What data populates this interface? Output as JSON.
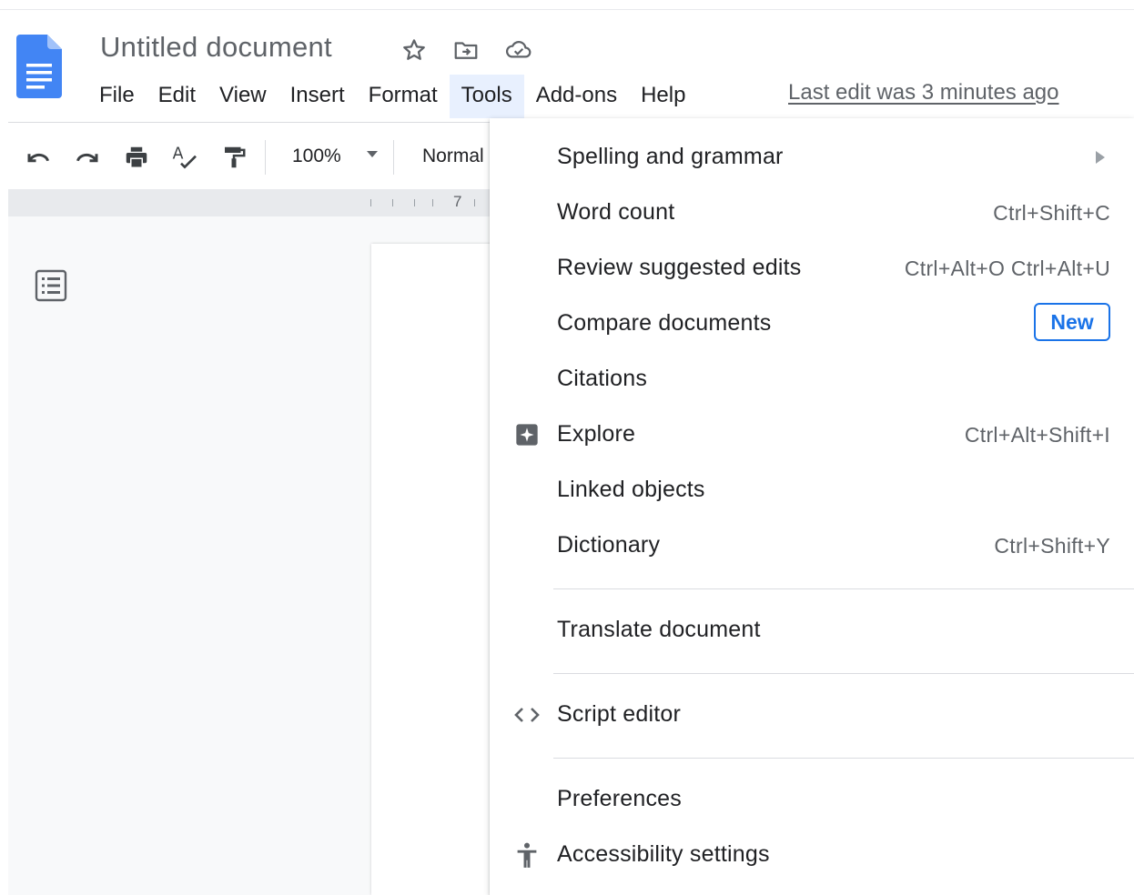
{
  "document": {
    "title": "Untitled document",
    "last_edit": "Last edit was 3 minutes ago"
  },
  "menubar": [
    {
      "label": "File",
      "name": "menu-file"
    },
    {
      "label": "Edit",
      "name": "menu-edit"
    },
    {
      "label": "View",
      "name": "menu-view"
    },
    {
      "label": "Insert",
      "name": "menu-insert"
    },
    {
      "label": "Format",
      "name": "menu-format"
    },
    {
      "label": "Tools",
      "name": "menu-tools",
      "active": true
    },
    {
      "label": "Add-ons",
      "name": "menu-add-ons"
    },
    {
      "label": "Help",
      "name": "menu-help"
    }
  ],
  "toolbar": {
    "zoom": "100%",
    "style": "Normal"
  },
  "ruler": {
    "label": "7"
  },
  "tools_menu": {
    "items": [
      {
        "label": "Spelling and grammar",
        "shortcut": "",
        "submenu": true
      },
      {
        "label": "Word count",
        "shortcut": "Ctrl+Shift+C"
      },
      {
        "label": "Review suggested edits",
        "shortcut": "Ctrl+Alt+O Ctrl+Alt+U"
      },
      {
        "label": "Compare documents",
        "badge": "New"
      },
      {
        "label": "Citations",
        "shortcut": ""
      },
      {
        "label": "Explore",
        "shortcut": "Ctrl+Alt+Shift+I",
        "icon": "explore-icon"
      },
      {
        "label": "Linked objects",
        "shortcut": ""
      },
      {
        "label": "Dictionary",
        "shortcut": "Ctrl+Shift+Y"
      },
      {
        "label": "Translate document",
        "shortcut": ""
      },
      {
        "label": "Script editor",
        "shortcut": "",
        "icon": "code-icon"
      },
      {
        "label": "Preferences",
        "shortcut": ""
      },
      {
        "label": "Accessibility settings",
        "shortcut": "",
        "icon": "accessibility-icon"
      }
    ]
  },
  "colors": {
    "accent": "#1a73e8",
    "doc_icon": "#4285f4",
    "menu_active_bg": "#e8f0fe",
    "muted_text": "#5f6368"
  }
}
